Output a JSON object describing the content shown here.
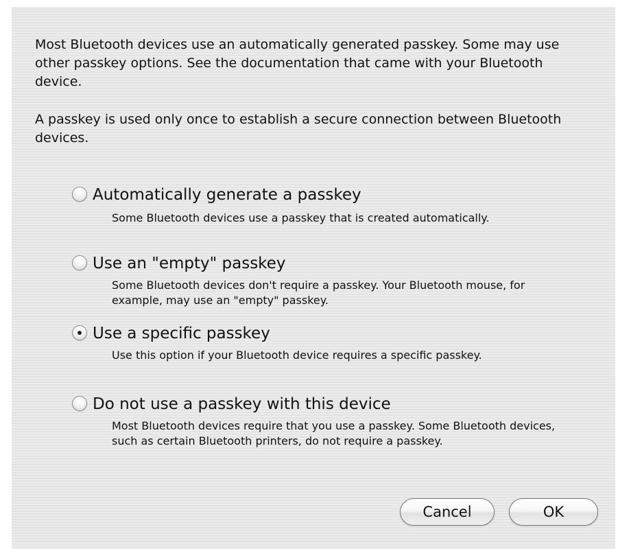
{
  "intro": {
    "paragraph1": "Most Bluetooth devices use an automatically generated passkey. Some may use other passkey options. See the documentation that came with your Bluetooth device.",
    "paragraph2": "A passkey is used only once to establish a secure connection between Bluetooth devices."
  },
  "options": [
    {
      "label": "Automatically generate a passkey",
      "description": "Some Bluetooth devices use a passkey that is created automatically.",
      "selected": false
    },
    {
      "label": "Use an \"empty\" passkey",
      "description": "Some Bluetooth devices don't require a passkey. Your Bluetooth mouse, for example, may use an \"empty\" passkey.",
      "selected": false
    },
    {
      "label": "Use a specific passkey",
      "description": "Use this option if your Bluetooth device requires a specific passkey.",
      "selected": true
    },
    {
      "label": "Do not use a passkey with this device",
      "description": "Most Bluetooth devices require that you use a passkey. Some Bluetooth devices, such as certain Bluetooth printers, do not require a passkey.",
      "selected": false
    }
  ],
  "buttons": {
    "cancel": "Cancel",
    "ok": "OK"
  }
}
